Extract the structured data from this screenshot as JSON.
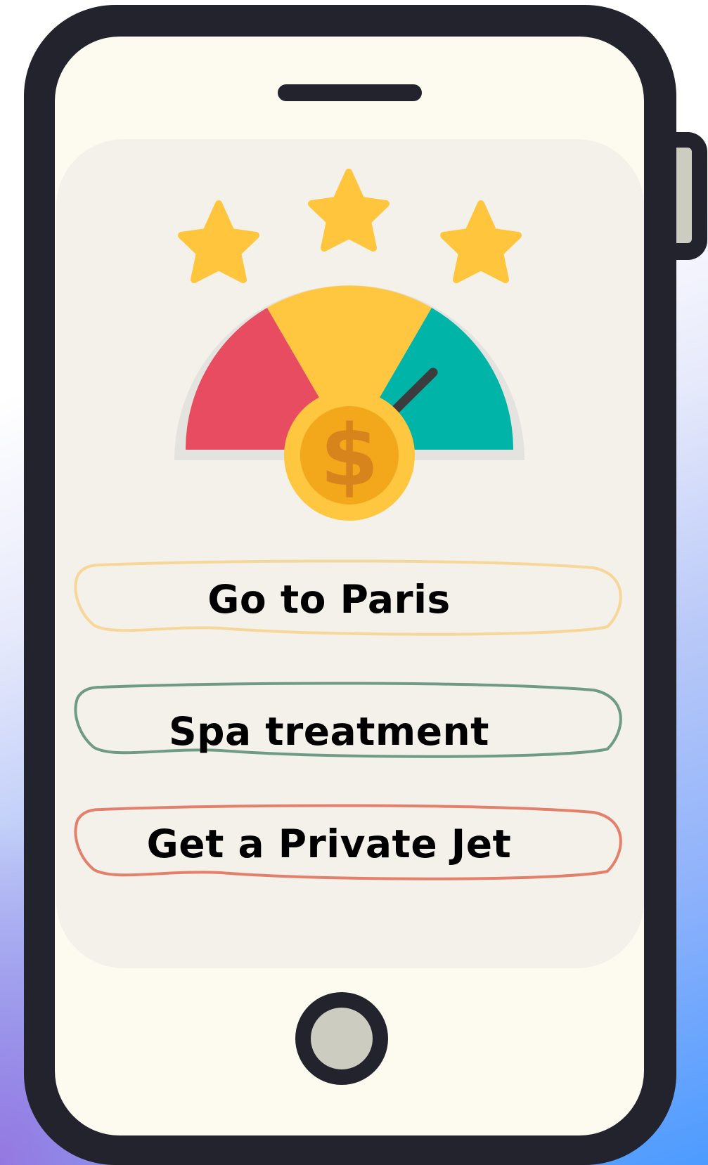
{
  "screen": {
    "options": [
      {
        "label": "Go to Paris",
        "color": "#f7d699"
      },
      {
        "label": "Spa treatment",
        "color": "#6e9a86"
      },
      {
        "label": "Get a Private Jet",
        "color": "#e3806c"
      }
    ]
  },
  "rating": {
    "stars_filled": 3,
    "stars_total": 3,
    "star_color": "#ffc53d"
  },
  "gauge": {
    "segments": [
      {
        "name": "low",
        "color": "#e84c61"
      },
      {
        "name": "mid",
        "color": "#ffc63f"
      },
      {
        "name": "high",
        "color": "#00b5a8"
      }
    ],
    "needle_level": "high",
    "coin_symbol": "$"
  },
  "phone": {
    "frame_color": "#22232c",
    "screen_color": "#fdfbef"
  }
}
